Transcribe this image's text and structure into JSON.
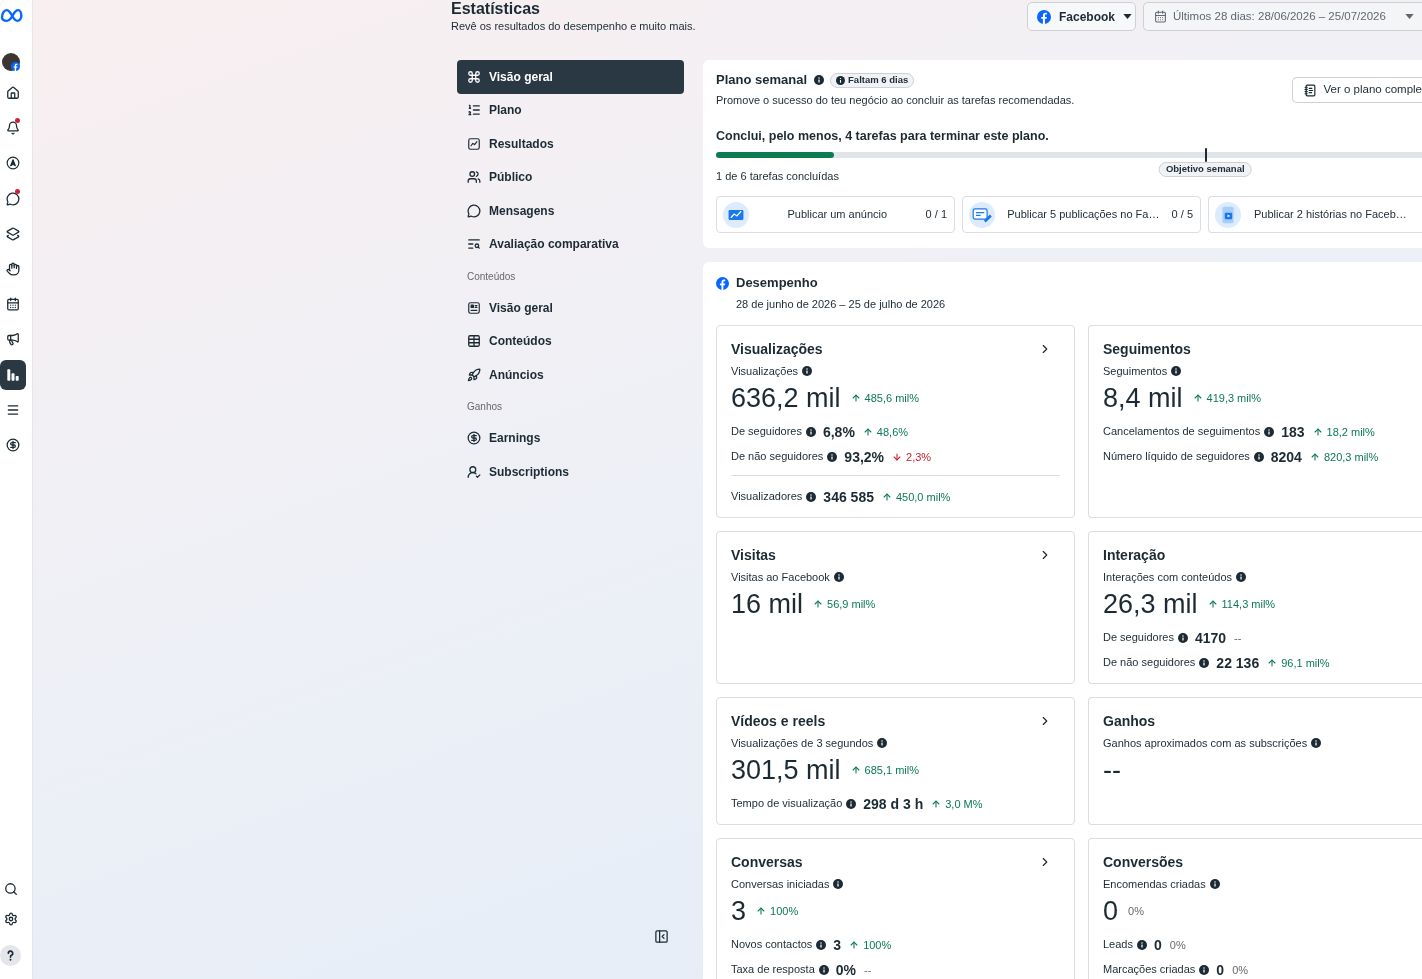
{
  "rail": {
    "items": [
      {
        "selected": false,
        "notification": false
      },
      {
        "selected": false,
        "notification": true
      },
      {
        "selected": false,
        "notification": false
      },
      {
        "selected": false,
        "notification": true
      },
      {
        "selected": false,
        "notification": false
      },
      {
        "selected": false,
        "notification": false
      },
      {
        "selected": false,
        "notification": false
      },
      {
        "selected": false,
        "notification": false
      },
      {
        "selected": true,
        "notification": false
      },
      {
        "selected": false,
        "notification": false
      },
      {
        "selected": false,
        "notification": false
      }
    ]
  },
  "header": {
    "title": "Estatísticas",
    "subtitle": "Revê os resultados do desempenho e muito mais."
  },
  "filters": {
    "platform": "Facebook",
    "date_range": "Últimos 28 dias: 28/06/2026 – 25/07/2026"
  },
  "nav": {
    "sections": [
      {
        "items": [
          {
            "label": "Visão geral",
            "selected": true
          },
          {
            "label": "Plano",
            "selected": false
          },
          {
            "label": "Resultados",
            "selected": false
          },
          {
            "label": "Público",
            "selected": false
          },
          {
            "label": "Mensagens",
            "selected": false
          },
          {
            "label": "Avaliação comparativa",
            "selected": false
          }
        ]
      },
      {
        "heading": "Conteúdos",
        "items": [
          {
            "label": "Visão geral",
            "selected": false
          },
          {
            "label": "Conteúdos",
            "selected": false
          },
          {
            "label": "Anúncios",
            "selected": false
          }
        ]
      },
      {
        "heading": "Ganhos",
        "items": [
          {
            "label": "Earnings",
            "selected": false
          },
          {
            "label": "Subscriptions",
            "selected": false
          }
        ]
      }
    ]
  },
  "plan": {
    "title": "Plano semanal",
    "badge": "Faltam 6 dias",
    "description": "Promove o sucesso do teu negócio ao concluir as tarefas recomendadas.",
    "button": "Ver o plano comple",
    "goal": "Conclui, pelo menos, 4 tarefas para terminar este plano.",
    "progress": {
      "level": 0.1667,
      "caption": "1 de 6 tarefas concluídas",
      "goal_label": "Objetivo semanal"
    },
    "tasks": [
      {
        "label": "Publicar um anúncio",
        "count": "0 / 1"
      },
      {
        "label": "Publicar 5 publicações no Fa…",
        "count": "0 / 5"
      },
      {
        "label": "Publicar 2 histórias no Faceb…"
      }
    ]
  },
  "performance": {
    "title": "Desempenho",
    "date_range": "28 de junho de 2026 – 25 de julho de 2026",
    "cards": [
      {
        "title": "Visualizações",
        "has_link": true,
        "metric": {
          "label": "Visualizações",
          "value": "636,2 mil",
          "change": "485,6 mil%",
          "rising": true,
          "falling": false
        },
        "rows": [
          {
            "label": "De seguidores",
            "value": "6,8%",
            "change": "48,6%",
            "rising": true,
            "falling": false
          },
          {
            "label": "De não seguidores",
            "value": "93,2%",
            "change": "2,3%",
            "rising": false,
            "falling": true
          }
        ],
        "footer": [
          {
            "label": "Visualizadores",
            "value": "346 585",
            "change": "450,0 mil%",
            "rising": true,
            "falling": false
          }
        ]
      },
      {
        "title": "Seguimentos",
        "has_link": false,
        "metric": {
          "label": "Seguimentos",
          "value": "8,4 mil",
          "change": "419,3 mil%",
          "rising": true,
          "falling": false
        },
        "rows": [
          {
            "label": "Cancelamentos de seguimentos",
            "value": "183",
            "change": "18,2 mil%",
            "rising": true,
            "falling": false
          },
          {
            "label": "Número líquido de seguidores",
            "value": "8204",
            "change": "820,3 mil%",
            "rising": true,
            "falling": false
          }
        ]
      },
      {
        "title": "Visitas",
        "has_link": true,
        "metric": {
          "label": "Visitas ao Facebook",
          "value": "16 mil",
          "change": "56,9 mil%",
          "rising": true,
          "falling": false
        }
      },
      {
        "title": "Interação",
        "has_link": false,
        "metric": {
          "label": "Interações com conteúdos",
          "value": "26,3 mil",
          "change": "114,3 mil%",
          "rising": true,
          "falling": false
        },
        "rows": [
          {
            "label": "De seguidores",
            "value": "4170",
            "change": "--",
            "rising": false,
            "falling": false
          },
          {
            "label": "De não seguidores",
            "value": "22 136",
            "change": "96,1 mil%",
            "rising": true,
            "falling": false
          }
        ]
      },
      {
        "title": "Vídeos e reels",
        "has_link": true,
        "metric": {
          "label": "Visualizações de 3 segundos",
          "value": "301,5 mil",
          "change": "685,1 mil%",
          "rising": true,
          "falling": false
        },
        "rows": [
          {
            "label": "Tempo de visualização",
            "value": "298 d 3 h",
            "change": "3,0 M%",
            "rising": true,
            "falling": false
          }
        ]
      },
      {
        "title": "Ganhos",
        "has_link": false,
        "metric": {
          "label": "Ganhos aproximados com as subscrições",
          "value": "--"
        }
      },
      {
        "title": "Conversas",
        "has_link": true,
        "metric": {
          "label": "Conversas iniciadas",
          "value": "3",
          "change": "100%",
          "rising": true,
          "falling": false
        },
        "rows": [
          {
            "label": "Novos contactos",
            "value": "3",
            "change": "100%",
            "rising": true,
            "falling": false
          },
          {
            "label": "Taxa de resposta",
            "value": "0%",
            "change": "--",
            "rising": false,
            "falling": false
          }
        ]
      },
      {
        "title": "Conversões",
        "has_link": false,
        "metric": {
          "label": "Encomendas criadas",
          "value": "0",
          "change": "0%",
          "rising": false,
          "falling": false
        },
        "rows": [
          {
            "label": "Leads",
            "value": "0",
            "change": "0%",
            "rising": false,
            "falling": false
          },
          {
            "label": "Marcações criadas",
            "value": "0",
            "change": "0%",
            "rising": false,
            "falling": false
          }
        ]
      }
    ]
  }
}
